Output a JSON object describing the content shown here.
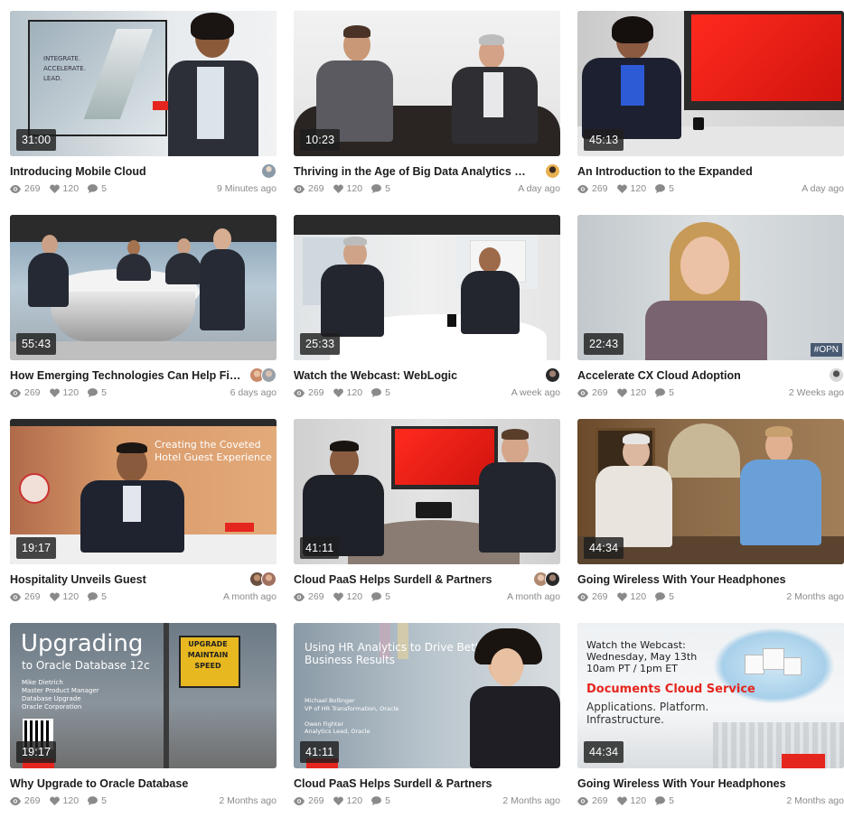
{
  "videos": [
    {
      "duration": "31:00",
      "title": "Introducing Mobile Cloud",
      "views": "269",
      "likes": "120",
      "comments": "5",
      "ago": "9 Minutes ago",
      "avatars": [
        "#8a9aa8"
      ]
    },
    {
      "duration": "10:23",
      "title": "Thriving in the Age of Big Data Analytics and Se...",
      "views": "269",
      "likes": "120",
      "comments": "5",
      "ago": "A day ago",
      "avatars": [
        "#c9964a"
      ]
    },
    {
      "duration": "45:13",
      "title": "An Introduction to the Expanded",
      "views": "269",
      "likes": "120",
      "comments": "5",
      "ago": "A day ago",
      "avatars": []
    },
    {
      "duration": "55:43",
      "title": "How Emerging Technologies Can Help Financ...",
      "views": "269",
      "likes": "120",
      "comments": "5",
      "ago": "6 days ago",
      "avatars": [
        "#c98a6a",
        "#9aa0a8"
      ]
    },
    {
      "duration": "25:33",
      "title": "Watch the Webcast: WebLogic",
      "views": "269",
      "likes": "120",
      "comments": "5",
      "ago": "A week ago",
      "avatars": [
        "#2a2a2a"
      ]
    },
    {
      "duration": "22:43",
      "title": "Accelerate CX Cloud Adoption",
      "views": "269",
      "likes": "120",
      "comments": "5",
      "ago": "2 Weeks ago",
      "avatars": [
        "#b0b0b0"
      ],
      "overlay_tag": "#OPN"
    },
    {
      "duration": "19:17",
      "title": "Hospitality Unveils Guest",
      "views": "269",
      "likes": "120",
      "comments": "5",
      "ago": "A month ago",
      "avatars": [
        "#6a5040",
        "#a07060"
      ],
      "overlay_text": [
        "Creating the Coveted",
        "Hotel Guest Experience"
      ]
    },
    {
      "duration": "41:11",
      "title": "Cloud PaaS Helps Surdell & Partners",
      "views": "269",
      "likes": "120",
      "comments": "5",
      "ago": "A month ago",
      "avatars": [
        "#b08a70",
        "#2a2a2a"
      ]
    },
    {
      "duration": "44:34",
      "title": "Going Wireless With Your Headphones",
      "views": "269",
      "likes": "120",
      "comments": "5",
      "ago": "2 Months ago",
      "avatars": []
    },
    {
      "duration": "19:17",
      "title": "Why Upgrade to Oracle Database",
      "views": "269",
      "likes": "120",
      "comments": "5",
      "ago": "2 Months ago",
      "avatars": [],
      "overlay_text": [
        "Upgrading",
        "to Oracle Database 12c",
        "Mike Dietrich",
        "Master Product Manager",
        "Database Upgrade",
        "Oracle Corporation",
        "UPGRADE",
        "MAINTAIN",
        "SPEED"
      ]
    },
    {
      "duration": "41:11",
      "title": "Cloud PaaS Helps Surdell & Partners",
      "views": "269",
      "likes": "120",
      "comments": "5",
      "ago": "2 Months ago",
      "avatars": [],
      "overlay_text": [
        "Using HR Analytics to Drive Better",
        "Business Results",
        "Michael Bollinger",
        "VP of HR Transformation, Oracle",
        "Owen Fighter",
        "Analytics Lead, Oracle"
      ]
    },
    {
      "duration": "44:34",
      "title": "Going Wireless With Your Headphones",
      "views": "269",
      "likes": "120",
      "comments": "5",
      "ago": "2 Months ago",
      "avatars": [],
      "overlay_text": [
        "Watch the Webcast:",
        "Wednesday, May 13th",
        "10am PT / 1pm ET",
        "Documents Cloud Service",
        "Applications. Platform.",
        "Infrastructure."
      ]
    }
  ],
  "colors": {
    "accent_red": "#e5261e",
    "meta_gray": "#8a8a8a"
  },
  "icons": {
    "views": "eye-icon",
    "likes": "heart-icon",
    "comments": "comment-icon"
  }
}
